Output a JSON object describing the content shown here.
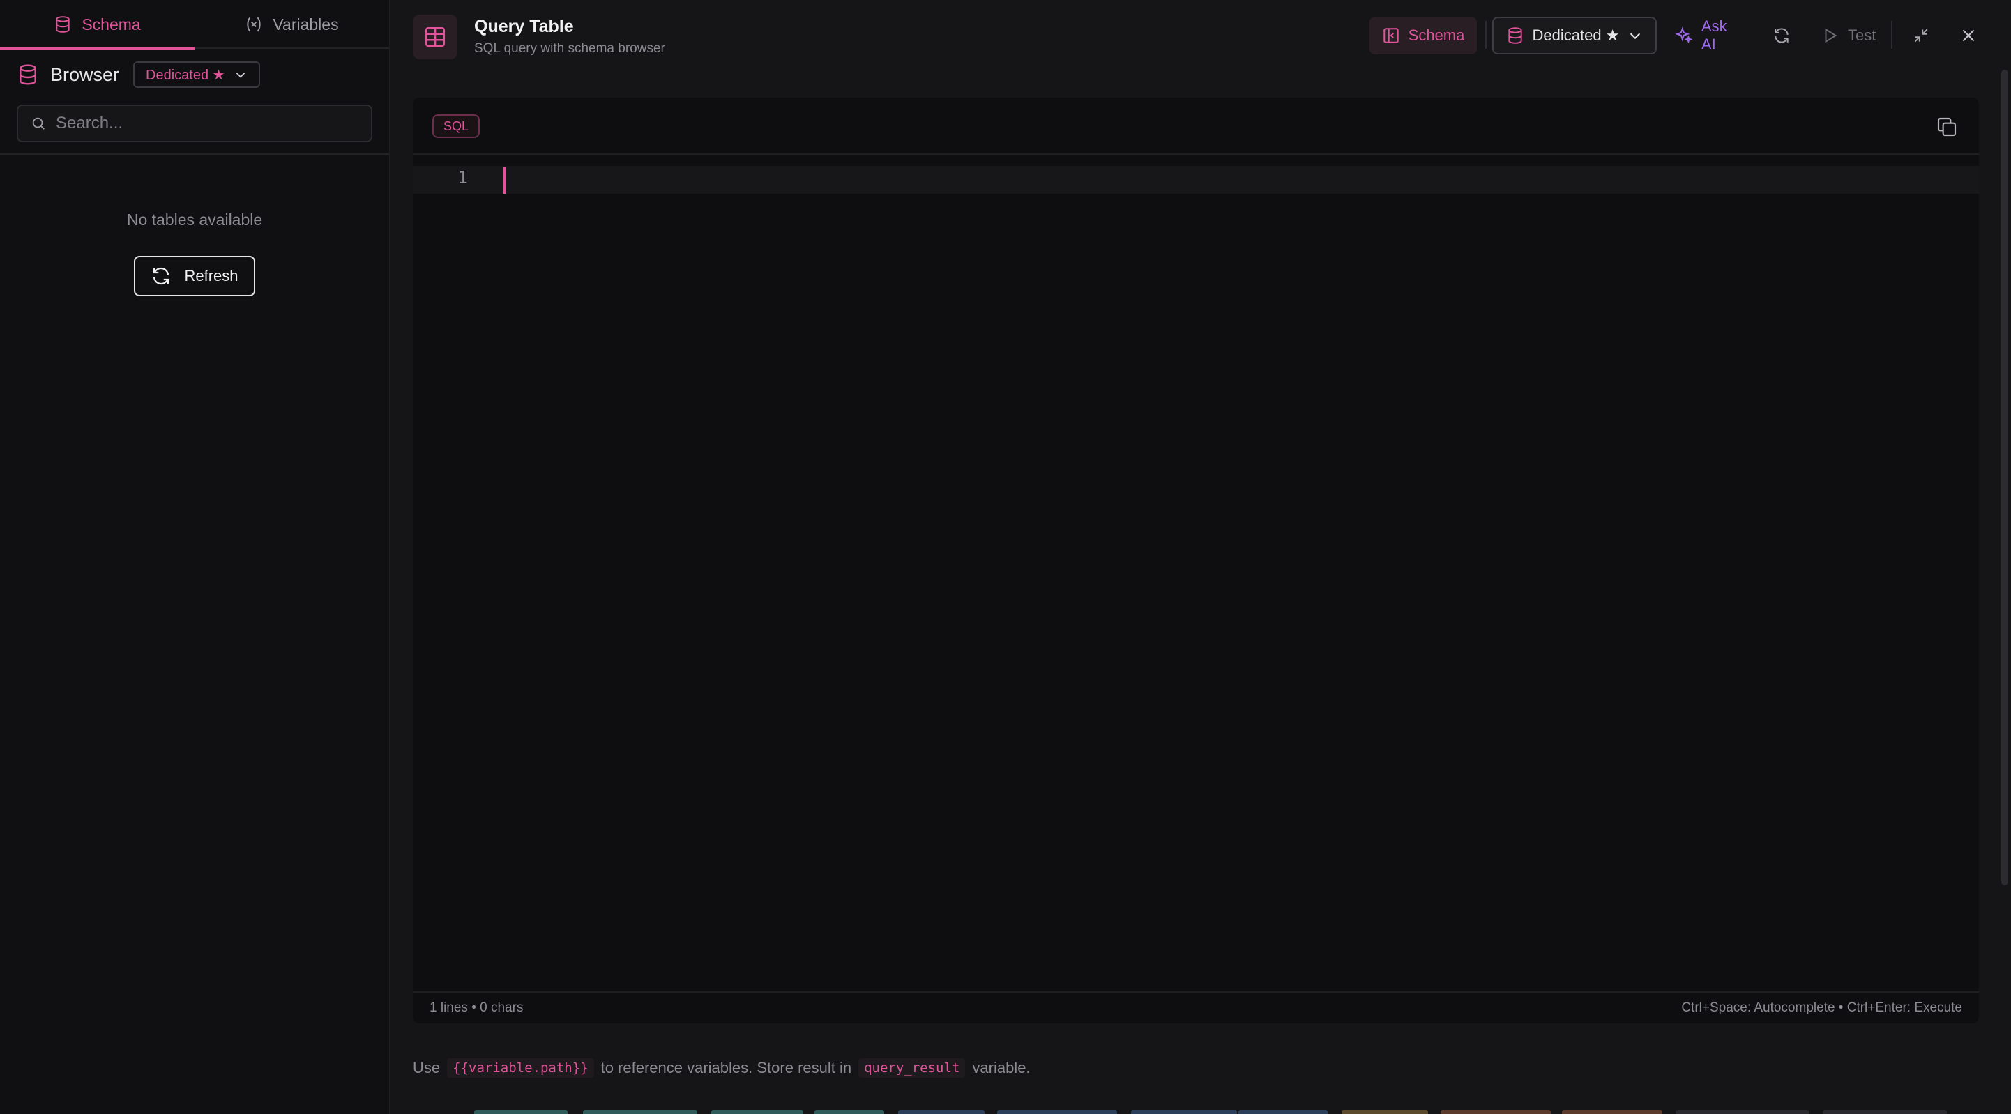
{
  "sidebar": {
    "tabs": [
      {
        "label": "Schema",
        "active": true,
        "icon": "database-icon"
      },
      {
        "label": "Variables",
        "active": false,
        "icon": "variable-icon"
      }
    ],
    "browser_title": "Browser",
    "connection_pill": "Dedicated ★",
    "search_placeholder": "Search...",
    "empty_message": "No tables available",
    "refresh_label": "Refresh"
  },
  "header": {
    "title": "Query Table",
    "subtitle": "SQL query with schema browser",
    "schema_button": "Schema",
    "connection_select": "Dedicated ★",
    "ask_ai_label": "Ask AI",
    "test_label": "Test"
  },
  "editor": {
    "language_badge": "SQL",
    "line_numbers": [
      "1"
    ],
    "status_left": "1 lines • 0 chars",
    "status_right": "Ctrl+Space: Autocomplete • Ctrl+Enter: Execute"
  },
  "hint": {
    "prefix": "Use",
    "variable_syntax": "{{variable.path}}",
    "middle": "to reference variables.  Store result in",
    "result_var": "query_result",
    "suffix": "variable."
  },
  "colors": {
    "accent": "#e0549a",
    "ai_accent": "#a06af0",
    "background": "#151517",
    "editor_background": "#0e0e10"
  }
}
